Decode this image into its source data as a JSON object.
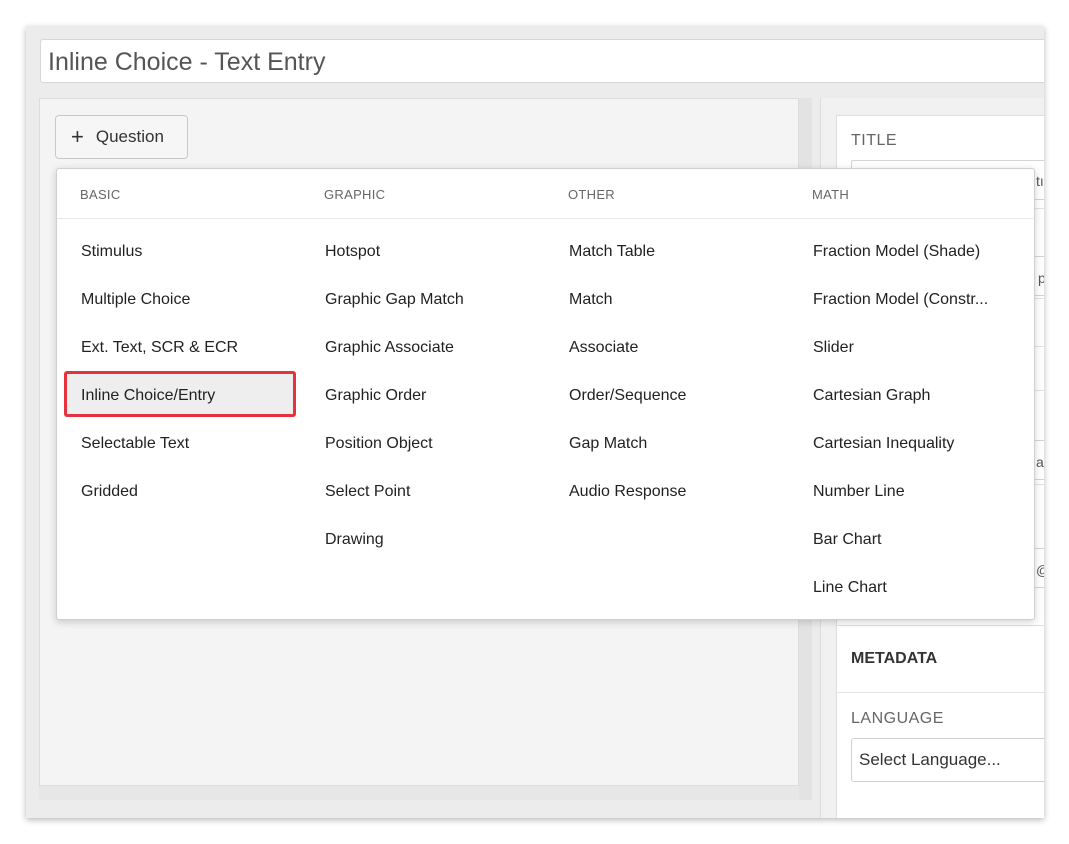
{
  "title": "Inline Choice - Text Entry",
  "add_button": {
    "icon": "plus-icon",
    "label": "Question"
  },
  "right_panel": {
    "title_label": "TITLE",
    "peek_chars": [
      "tı",
      "p",
      "a",
      "@"
    ],
    "metadata": {
      "title": "METADATA",
      "language_label": "LANGUAGE",
      "language_value": "Select Language..."
    }
  },
  "dropdown": {
    "columns": [
      {
        "heading": "BASIC",
        "items": [
          "Stimulus",
          "Multiple Choice",
          "Ext. Text, SCR & ECR",
          "Inline Choice/Entry",
          "Selectable Text",
          "Gridded"
        ]
      },
      {
        "heading": "GRAPHIC",
        "items": [
          "Hotspot",
          "Graphic Gap Match",
          "Graphic Associate",
          "Graphic Order",
          "Position Object",
          "Select Point",
          "Drawing"
        ]
      },
      {
        "heading": "OTHER",
        "items": [
          "Match Table",
          "Match",
          "Associate",
          "Order/Sequence",
          "Gap Match",
          "Audio Response"
        ]
      },
      {
        "heading": "MATH",
        "items": [
          "Fraction Model (Shade)",
          "Fraction Model (Constr...",
          "Slider",
          "Cartesian Graph",
          "Cartesian Inequality",
          "Number Line",
          "Bar Chart",
          "Line Chart"
        ]
      }
    ],
    "highlighted_item": "Inline Choice/Entry",
    "highlight_color": "#e5323f"
  }
}
